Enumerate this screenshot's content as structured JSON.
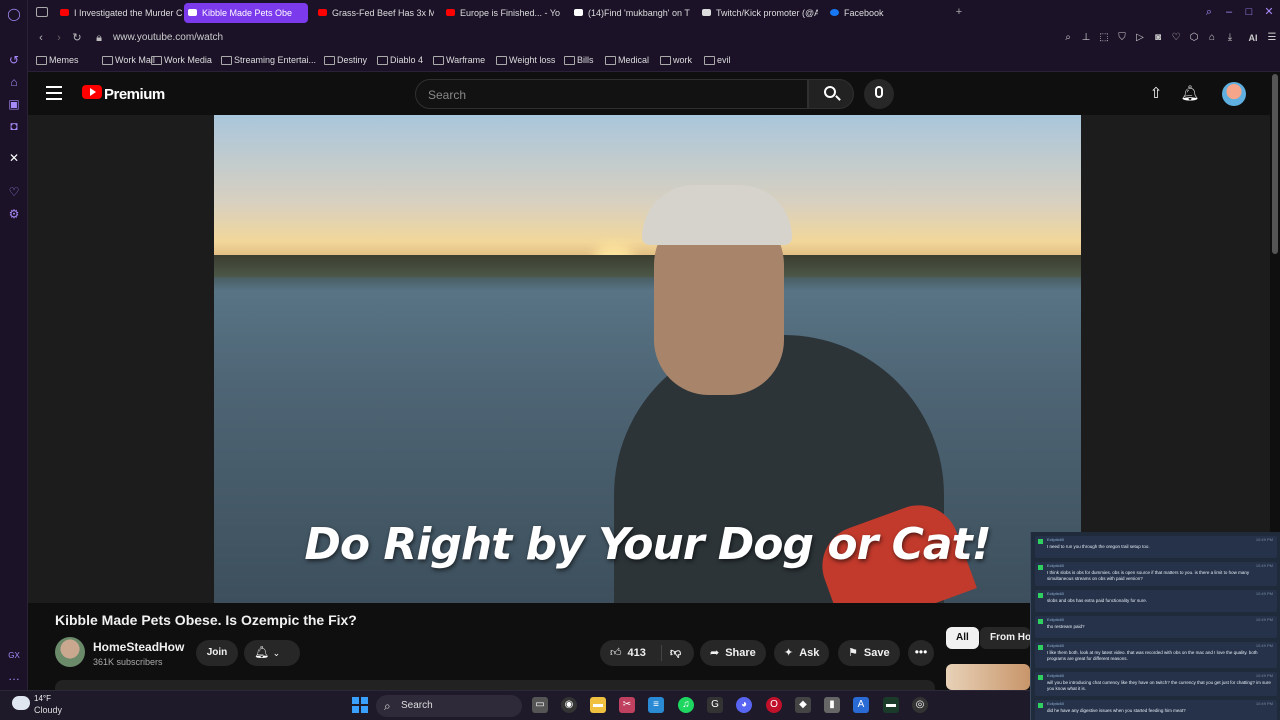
{
  "tabs": [
    {
      "label": "I Investigated the Murder C",
      "active": false
    },
    {
      "label": "Kibble Made Pets Obe",
      "active": true
    },
    {
      "label": "Grass-Fed Beef Has 3x M",
      "active": false
    },
    {
      "label": "Europe is Finished... - You",
      "active": false
    },
    {
      "label": "(14)Find 'mukbangh' on T",
      "active": false
    },
    {
      "label": "Twitch/Kick promoter (@A",
      "active": false
    },
    {
      "label": "Facebook",
      "active": false
    }
  ],
  "address_bar": {
    "url": "www.youtube.com/watch",
    "ai_label": "AI"
  },
  "bookmarks": [
    "Memes",
    "Work Mail",
    "Work Media",
    "Streaming Entertai...",
    "Destiny",
    "Diablo 4",
    "Warframe",
    "Weight loss",
    "Bills",
    "Medical",
    "work",
    "evil"
  ],
  "youtube": {
    "brand": "Premium",
    "search_placeholder": "Search",
    "video_caption": "Do Right by Your Dog or Cat!",
    "video_title": "Kibble Made Pets Obese. Is Ozempic the Fix?",
    "channel_name": "HomeSteadHow",
    "subscribers": "361K subscribers",
    "join_label": "Join",
    "like_count": "413",
    "share_label": "Share",
    "ask_label": "Ask",
    "save_label": "Save",
    "chips": [
      "All",
      "From Ho"
    ]
  },
  "chat": [
    {
      "user": "Ecliptic60",
      "time": "10:49 PM",
      "text": "I need to run you through the oregon trail setup too."
    },
    {
      "user": "Ecliptic60",
      "time": "10:49 PM",
      "text": "I think slobs is obs for dummies. obs is open source if that matters to you. is there a limit to how many simultaneous streams on obs with paid version?"
    },
    {
      "user": "Ecliptic60",
      "time": "10:49 PM",
      "text": "slobs and obs has extra paid functionality for sure."
    },
    {
      "user": "Ecliptic60",
      "time": "10:49 PM",
      "text": "tho restream paid?"
    },
    {
      "user": "Ecliptic60",
      "time": "10:49 PM",
      "text": "I like them both. look at my latest video. that was recorded with obs on the mac and I love the quality. both programs are great for different reasons."
    },
    {
      "user": "Ecliptic60",
      "time": "10:49 PM",
      "text": "will you be introducing chat currency like they have on twitch? the currency that you get just for chatting? im sure you know what it is."
    },
    {
      "user": "Ecliptic60",
      "time": "10:49 PM",
      "text": "did he have any digestive issues when you started feeding him meat?"
    }
  ],
  "taskbar": {
    "temperature": "14°F",
    "weather": "Cloudy",
    "search_label": "Search"
  },
  "colors": {
    "accent": "#7c3aed",
    "youtube_red": "#ff0000",
    "opera_bg": "#1b1228"
  }
}
